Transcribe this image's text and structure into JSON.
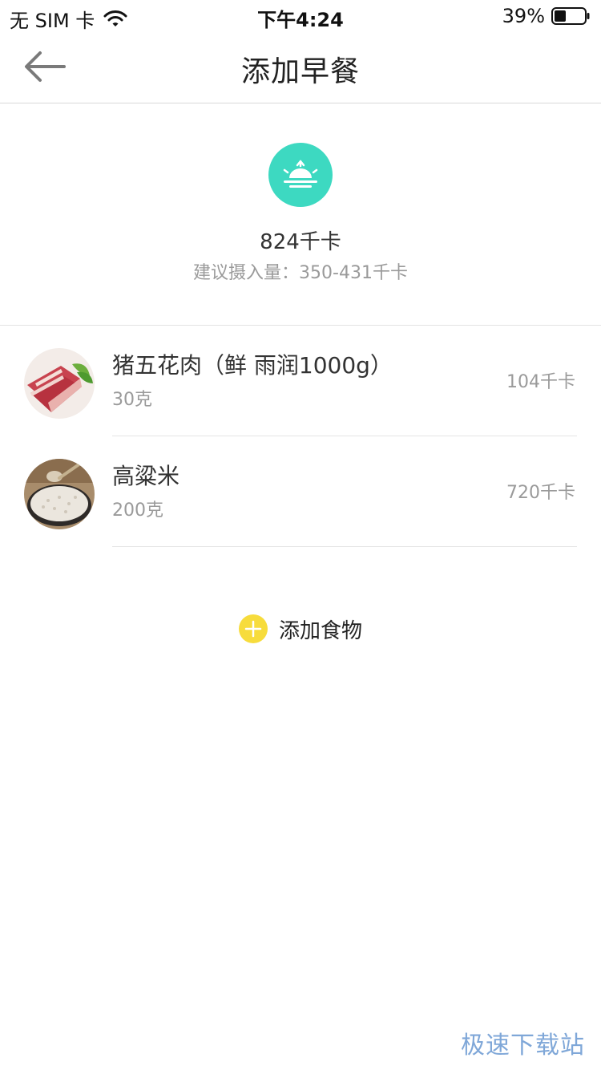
{
  "status_bar": {
    "carrier": "无 SIM 卡",
    "time": "下午4:24",
    "battery": "39%"
  },
  "nav": {
    "title": "添加早餐",
    "back_icon": "arrow-left-icon"
  },
  "summary": {
    "icon": "sunrise-icon",
    "icon_color": "#3dd9c1",
    "total": "824千卡",
    "suggest": "建议摄入量：350-431千卡"
  },
  "foods": [
    {
      "name": "猪五花肉（鲜 雨润1000g）",
      "amount": "30克",
      "calories": "104千卡"
    },
    {
      "name": "高粱米",
      "amount": "200克",
      "calories": "720千卡"
    }
  ],
  "add_food": {
    "label": "添加食物",
    "icon": "plus-circle-icon",
    "icon_color": "#f7dc3c"
  },
  "watermark": "极速下载站"
}
